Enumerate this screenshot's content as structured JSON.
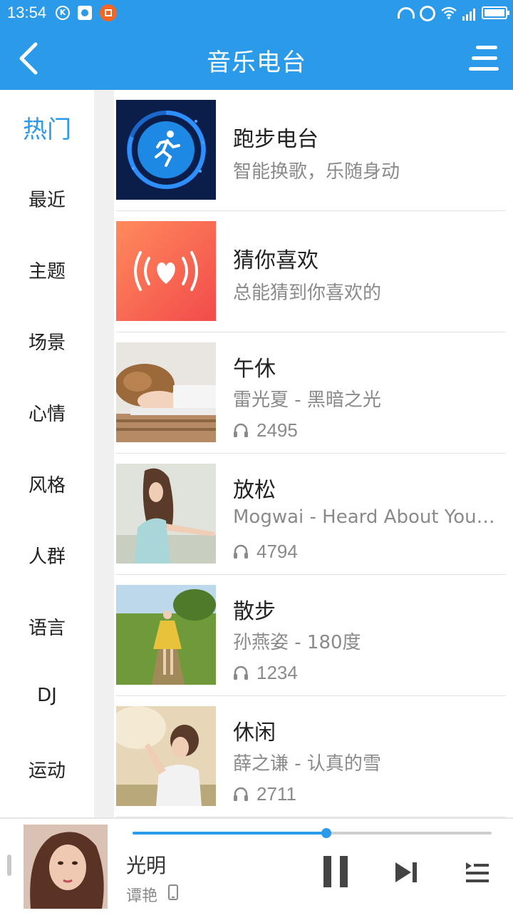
{
  "status_bar": {
    "time": "13:54",
    "icons": [
      "k-icon",
      "baidu-paw-icon",
      "orange-app-icon",
      "headphone-icon",
      "alarm-icon",
      "wifi-icon",
      "signal-icon",
      "battery-icon"
    ]
  },
  "header": {
    "title": "音乐电台",
    "back_icon": "chevron-left-icon",
    "menu_icon": "menu-icon"
  },
  "colors": {
    "primary": "#2b9ae8",
    "text_primary": "#222222",
    "text_secondary": "#8a8a8a"
  },
  "sidebar": {
    "items": [
      {
        "label": "热门",
        "active": true
      },
      {
        "label": "最近",
        "active": false
      },
      {
        "label": "主题",
        "active": false
      },
      {
        "label": "场景",
        "active": false
      },
      {
        "label": "心情",
        "active": false
      },
      {
        "label": "风格",
        "active": false
      },
      {
        "label": "人群",
        "active": false
      },
      {
        "label": "语言",
        "active": false
      },
      {
        "label": "DJ",
        "active": false
      },
      {
        "label": "运动",
        "active": false
      }
    ]
  },
  "stations": [
    {
      "title": "跑步电台",
      "subtitle": "智能换歌，乐随身动",
      "count": null,
      "thumb": "running-thumbnail"
    },
    {
      "title": "猜你喜欢",
      "subtitle": "总能猜到你喜欢的",
      "count": null,
      "thumb": "heart-broadcast-thumbnail"
    },
    {
      "title": "午休",
      "subtitle": "雷光夏 - 黑暗之光",
      "count": "2495",
      "thumb": "sleeping-boy-thumbnail"
    },
    {
      "title": "放松",
      "subtitle": "Mogwai - Heard About You Last Night",
      "count": "4794",
      "thumb": "relaxing-woman-thumbnail"
    },
    {
      "title": "散步",
      "subtitle": "孙燕姿 - 180度",
      "count": "1234",
      "thumb": "walking-woman-thumbnail"
    },
    {
      "title": "休闲",
      "subtitle": "薛之谦 - 认真的雪",
      "count": "2711",
      "thumb": "leisure-woman-thumbnail"
    }
  ],
  "player": {
    "song_title": "光明",
    "artist": "谭艳",
    "progress": 0.54,
    "icons": [
      "pause-icon",
      "next-icon",
      "queue-icon"
    ]
  }
}
